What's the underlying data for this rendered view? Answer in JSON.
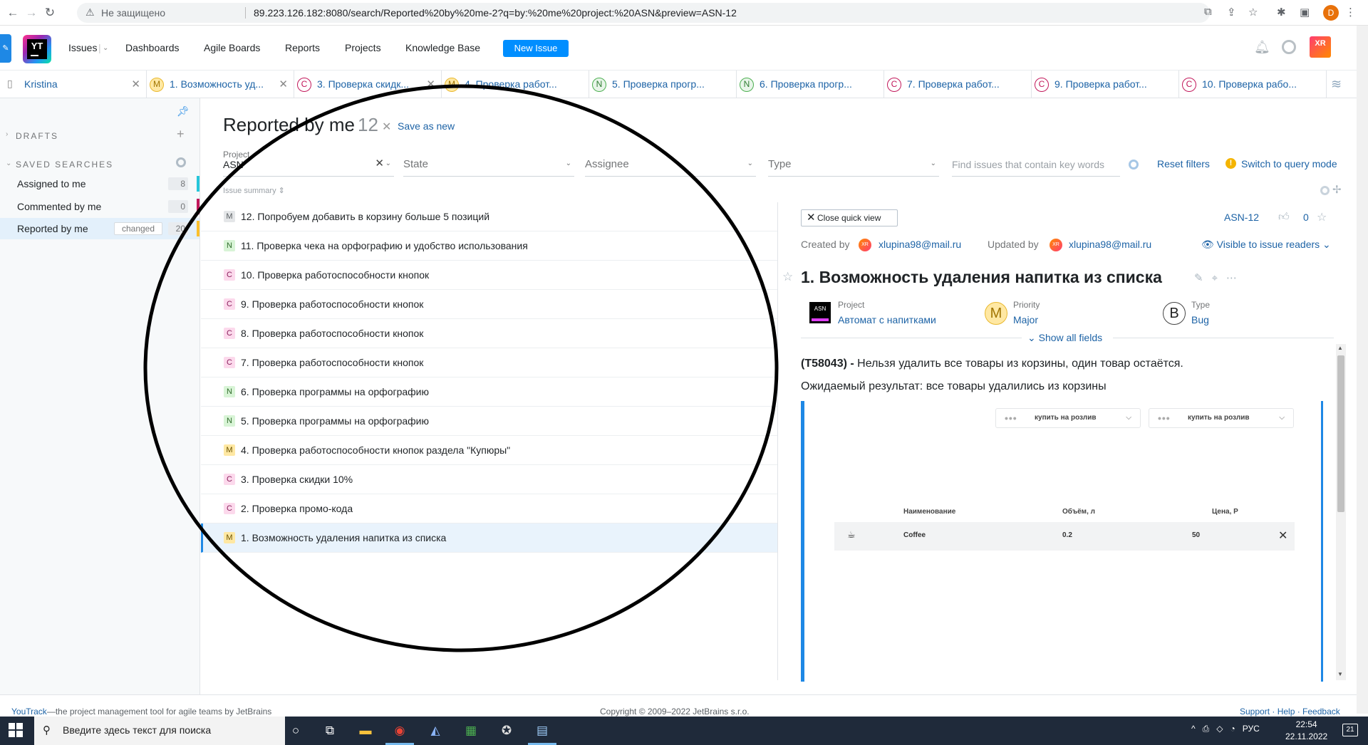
{
  "browser": {
    "insecure_label": "Не защищено",
    "url": "89.223.126.182:8080/search/Reported%20by%20me-2?q=by:%20me%20project:%20ASN&preview=ASN-12",
    "profile_initial": "D"
  },
  "header": {
    "logo_text": "YT",
    "nav": {
      "issues": "Issues",
      "dashboards": "Dashboards",
      "agile_boards": "Agile Boards",
      "reports": "Reports",
      "projects": "Projects",
      "knowledge_base": "Knowledge Base"
    },
    "new_issue": "New Issue",
    "avatar_initials": "XR"
  },
  "tabs": [
    {
      "badge": "",
      "label": "Kristina",
      "color": "#737577"
    },
    {
      "badge": "M",
      "label": "1. Возможность уд...",
      "color": "#e9b82e"
    },
    {
      "badge": "C",
      "label": "3. Проверка скидк...",
      "color": "#c2185b"
    },
    {
      "badge": "M",
      "label": "4. Проверка работ...",
      "color": "#e9b82e"
    },
    {
      "badge": "N",
      "label": "5. Проверка прогр...",
      "color": "#4caf50"
    },
    {
      "badge": "N",
      "label": "6. Проверка прогр...",
      "color": "#4caf50"
    },
    {
      "badge": "C",
      "label": "7. Проверка работ...",
      "color": "#c2185b"
    },
    {
      "badge": "C",
      "label": "9. Проверка работ...",
      "color": "#c2185b"
    },
    {
      "badge": "C",
      "label": "10. Проверка рабо...",
      "color": "#c2185b"
    }
  ],
  "sidebar": {
    "drafts": "DRAFTS",
    "saved_searches": "SAVED SEARCHES",
    "items": [
      {
        "label": "Assigned to me",
        "count": "8",
        "color": "#26c6da"
      },
      {
        "label": "Commented by me",
        "count": "0",
        "color": "#c2185b"
      },
      {
        "label": "Reported by me",
        "count": "20",
        "color": "#fbc02d",
        "changed": "changed"
      }
    ]
  },
  "main": {
    "title": "Reported by me",
    "count": "12",
    "save_as_new": "Save as new",
    "filters": {
      "project_label": "Project",
      "project_value": "ASN",
      "state": "State",
      "assignee": "Assignee",
      "type": "Type",
      "search_placeholder": "Find issues that contain key words"
    },
    "reset_filters": "Reset filters",
    "query_mode": "Switch to query mode",
    "sort_header": "Issue summary ⇕"
  },
  "issues": [
    {
      "badge": "M",
      "cls": "b-Mg",
      "title": "12. Попробуем добавить в корзину больше 5 позиций"
    },
    {
      "badge": "N",
      "cls": "b-N",
      "title": "11. Проверка чека на орфографию и удобство использования"
    },
    {
      "badge": "C",
      "cls": "b-C",
      "title": "10. Проверка работоспособности кнопок"
    },
    {
      "badge": "C",
      "cls": "b-C",
      "title": "9. Проверка работоспособности кнопок"
    },
    {
      "badge": "C",
      "cls": "b-C",
      "title": "8. Проверка работоспособности кнопок"
    },
    {
      "badge": "C",
      "cls": "b-C",
      "title": "7. Проверка работоспособности кнопок"
    },
    {
      "badge": "N",
      "cls": "b-N",
      "title": "6. Проверка программы на орфографию"
    },
    {
      "badge": "N",
      "cls": "b-N",
      "title": "5. Проверка программы на орфографию"
    },
    {
      "badge": "M",
      "cls": "b-M",
      "title": "4. Проверка работоспособности кнопок раздела \"Купюры\""
    },
    {
      "badge": "C",
      "cls": "b-C",
      "title": "3. Проверка скидки 10%"
    },
    {
      "badge": "C",
      "cls": "b-C",
      "title": "2. Проверка промо-кода"
    },
    {
      "badge": "M",
      "cls": "b-M",
      "title": "1. Возможность удаления напитка из списка",
      "selected": true
    }
  ],
  "quickview": {
    "close": "Close quick view",
    "issue_id": "ASN-12",
    "votes": "0",
    "created_by_label": "Created by",
    "creator": "xlupina98@mail.ru",
    "updated_by_label": "Updated by",
    "updater": "xlupina98@mail.ru",
    "visibility": "Visible to issue readers",
    "title": "1. Возможность удаления напитка из списка",
    "fields": {
      "project_label": "Project",
      "project_value": "Автомат с напитками",
      "project_icon": "ASN",
      "priority_label": "Priority",
      "priority_value": "Major",
      "priority_icon": "M",
      "type_label": "Type",
      "type_value": "Bug",
      "type_icon": "B"
    },
    "show_all_fields": "Show all fields",
    "desc_id": "(T58043) -",
    "desc_text": " Нельзя удалить все товары из корзины, один товар остаётся.",
    "desc_line2": "Ожидаемый результат: все товары удалились из корзины",
    "attachment": {
      "dropdown1": "купить на розлив",
      "dropdown2": "купить на розлив",
      "col_name": "Наименование",
      "col_volume": "Объём, л",
      "col_price": "Цена, Р",
      "row_name": "Coffee",
      "row_volume": "0.2",
      "row_price": "50"
    }
  },
  "footer": {
    "left_link": "YouTrack",
    "left_text": "—the project management tool for agile teams by JetBrains",
    "copyright": "Copyright © 2009–2022 JetBrains s.r.o.",
    "right": "Support · Help · Feedback"
  },
  "taskbar": {
    "search_placeholder": "Введите здесь текст для поиска",
    "lang": "РУС",
    "time": "22:54",
    "date": "22.11.2022",
    "notifications": "21"
  }
}
